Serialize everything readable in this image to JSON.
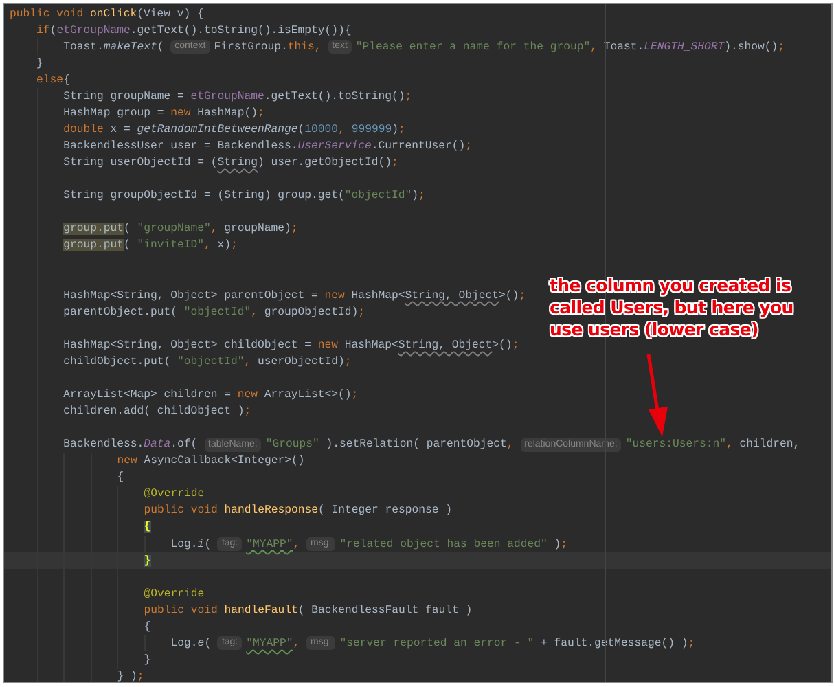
{
  "editor": {
    "lines": [
      {
        "kind": "code",
        "tokens": [
          {
            "kind": "keyword",
            "text": "public void "
          },
          {
            "kind": "method",
            "text": "onClick"
          },
          {
            "kind": "plain",
            "text": "(View v) {"
          }
        ],
        "children": [
          {
            "kind": "code",
            "tokens": [
              {
                "kind": "keyword",
                "text": "if"
              },
              {
                "kind": "plain",
                "text": "("
              },
              {
                "kind": "field",
                "text": "etGroupName"
              },
              {
                "kind": "plain",
                "text": ".getText().toString().isEmpty()){"
              }
            ],
            "children": [
              {
                "kind": "code",
                "tokens": [
                  {
                    "kind": "plain",
                    "text": "Toast."
                  },
                  {
                    "kind": "italic",
                    "text": "makeText"
                  },
                  {
                    "kind": "plain",
                    "text": "( "
                  },
                  {
                    "kind": "hint",
                    "text": "context"
                  },
                  {
                    "kind": "plain",
                    "text": "FirstGroup."
                  },
                  {
                    "kind": "keyword",
                    "text": "this, "
                  },
                  {
                    "kind": "hint",
                    "text": "text"
                  },
                  {
                    "kind": "string",
                    "text": "\"Please enter a name for the group\""
                  },
                  {
                    "kind": "keyword",
                    "text": ", "
                  },
                  {
                    "kind": "plain",
                    "text": "Toast."
                  },
                  {
                    "kind": "static",
                    "text": "LENGTH_SHORT"
                  },
                  {
                    "kind": "plain",
                    "text": ").show()"
                  },
                  {
                    "kind": "keyword",
                    "text": ";"
                  }
                ]
              }
            ]
          },
          {
            "kind": "code",
            "tokens": [
              {
                "kind": "plain",
                "text": "}"
              }
            ]
          },
          {
            "kind": "code",
            "tokens": [
              {
                "kind": "keyword",
                "text": "else"
              },
              {
                "kind": "plain",
                "text": "{"
              }
            ],
            "children": [
              {
                "kind": "code",
                "tokens": [
                  {
                    "kind": "plain",
                    "text": "String groupName = "
                  },
                  {
                    "kind": "field",
                    "text": "etGroupName"
                  },
                  {
                    "kind": "plain",
                    "text": ".getText().toString()"
                  },
                  {
                    "kind": "keyword",
                    "text": ";"
                  }
                ]
              },
              {
                "kind": "code",
                "tokens": [
                  {
                    "kind": "plain",
                    "text": "HashMap group = "
                  },
                  {
                    "kind": "keyword",
                    "text": "new "
                  },
                  {
                    "kind": "plain",
                    "text": "HashMap()"
                  },
                  {
                    "kind": "keyword",
                    "text": ";"
                  }
                ]
              },
              {
                "kind": "code",
                "tokens": [
                  {
                    "kind": "keyword",
                    "text": "double "
                  },
                  {
                    "kind": "plain",
                    "text": "x = "
                  },
                  {
                    "kind": "italic",
                    "text": "getRandomIntBetweenRange"
                  },
                  {
                    "kind": "plain",
                    "text": "("
                  },
                  {
                    "kind": "number",
                    "text": "10000"
                  },
                  {
                    "kind": "keyword",
                    "text": ", "
                  },
                  {
                    "kind": "number",
                    "text": "999999"
                  },
                  {
                    "kind": "plain",
                    "text": ")"
                  },
                  {
                    "kind": "keyword",
                    "text": ";"
                  }
                ]
              },
              {
                "kind": "code",
                "tokens": [
                  {
                    "kind": "plain",
                    "text": "BackendlessUser user = Backendless."
                  },
                  {
                    "kind": "static",
                    "text": "UserService"
                  },
                  {
                    "kind": "plain",
                    "text": ".CurrentUser()"
                  },
                  {
                    "kind": "keyword",
                    "text": ";"
                  }
                ]
              },
              {
                "kind": "code",
                "tokens": [
                  {
                    "kind": "plain",
                    "text": "String userObjectId = ("
                  },
                  {
                    "kind": "plain",
                    "text": "String",
                    "squiggly": true
                  },
                  {
                    "kind": "plain",
                    "text": ") user.getObjectId()"
                  },
                  {
                    "kind": "keyword",
                    "text": ";"
                  }
                ]
              },
              {
                "kind": "blank"
              },
              {
                "kind": "code",
                "tokens": [
                  {
                    "kind": "plain",
                    "text": "String groupObjectId = (String) group.get("
                  },
                  {
                    "kind": "string",
                    "text": "\"objectId\""
                  },
                  {
                    "kind": "plain",
                    "text": ")"
                  },
                  {
                    "kind": "keyword",
                    "text": ";"
                  }
                ]
              },
              {
                "kind": "blank"
              },
              {
                "kind": "code",
                "tokens": [
                  {
                    "kind": "plain",
                    "text": "group.put",
                    "highlighted": true
                  },
                  {
                    "kind": "plain",
                    "text": "( "
                  },
                  {
                    "kind": "string",
                    "text": "\"groupName\""
                  },
                  {
                    "kind": "keyword",
                    "text": ", "
                  },
                  {
                    "kind": "plain",
                    "text": "groupName)"
                  },
                  {
                    "kind": "keyword",
                    "text": ";"
                  }
                ]
              },
              {
                "kind": "code",
                "tokens": [
                  {
                    "kind": "plain",
                    "text": "group.put",
                    "highlighted": true
                  },
                  {
                    "kind": "plain",
                    "text": "( "
                  },
                  {
                    "kind": "string",
                    "text": "\"inviteID\""
                  },
                  {
                    "kind": "keyword",
                    "text": ", "
                  },
                  {
                    "kind": "plain",
                    "text": "x)"
                  },
                  {
                    "kind": "keyword",
                    "text": ";"
                  }
                ]
              },
              {
                "kind": "blank"
              },
              {
                "kind": "blank"
              },
              {
                "kind": "code",
                "tokens": [
                  {
                    "kind": "plain",
                    "text": "HashMap<String, Object> parentObject = "
                  },
                  {
                    "kind": "keyword",
                    "text": "new "
                  },
                  {
                    "kind": "plain",
                    "text": "HashMap<"
                  },
                  {
                    "kind": "plain",
                    "text": "String, Object",
                    "squiggly": true
                  },
                  {
                    "kind": "plain",
                    "text": ">()"
                  },
                  {
                    "kind": "keyword",
                    "text": ";"
                  }
                ]
              },
              {
                "kind": "code",
                "tokens": [
                  {
                    "kind": "plain",
                    "text": "parentObject.put( "
                  },
                  {
                    "kind": "string",
                    "text": "\"objectId\""
                  },
                  {
                    "kind": "keyword",
                    "text": ", "
                  },
                  {
                    "kind": "plain",
                    "text": "groupObjectId)"
                  },
                  {
                    "kind": "keyword",
                    "text": ";"
                  }
                ]
              },
              {
                "kind": "blank"
              },
              {
                "kind": "code",
                "tokens": [
                  {
                    "kind": "plain",
                    "text": "HashMap<String, Object> childObject = "
                  },
                  {
                    "kind": "keyword",
                    "text": "new "
                  },
                  {
                    "kind": "plain",
                    "text": "HashMap<"
                  },
                  {
                    "kind": "plain",
                    "text": "String, Object",
                    "squiggly": true
                  },
                  {
                    "kind": "plain",
                    "text": ">()"
                  },
                  {
                    "kind": "keyword",
                    "text": ";"
                  }
                ]
              },
              {
                "kind": "code",
                "tokens": [
                  {
                    "kind": "plain",
                    "text": "childObject.put( "
                  },
                  {
                    "kind": "string",
                    "text": "\"objectId\""
                  },
                  {
                    "kind": "keyword",
                    "text": ", "
                  },
                  {
                    "kind": "plain",
                    "text": "userObjectId)"
                  },
                  {
                    "kind": "keyword",
                    "text": ";"
                  }
                ]
              },
              {
                "kind": "blank"
              },
              {
                "kind": "code",
                "tokens": [
                  {
                    "kind": "plain",
                    "text": "ArrayList<Map> children = "
                  },
                  {
                    "kind": "keyword",
                    "text": "new "
                  },
                  {
                    "kind": "plain",
                    "text": "ArrayList<>()"
                  },
                  {
                    "kind": "keyword",
                    "text": ";"
                  }
                ]
              },
              {
                "kind": "code",
                "tokens": [
                  {
                    "kind": "plain",
                    "text": "children.add( childObject )"
                  },
                  {
                    "kind": "keyword",
                    "text": ";"
                  }
                ]
              },
              {
                "kind": "blank"
              },
              {
                "kind": "code",
                "tokens": [
                  {
                    "kind": "plain",
                    "text": "Backendless."
                  },
                  {
                    "kind": "static",
                    "text": "Data"
                  },
                  {
                    "kind": "plain",
                    "text": ".of( "
                  },
                  {
                    "kind": "hint",
                    "text": "tableName:"
                  },
                  {
                    "kind": "string",
                    "text": "\"Groups\""
                  },
                  {
                    "kind": "plain",
                    "text": " ).setRelation( parentObject"
                  },
                  {
                    "kind": "keyword",
                    "text": ", "
                  },
                  {
                    "kind": "hint",
                    "text": "relationColumnName:"
                  },
                  {
                    "kind": "string",
                    "text": "\"users:Users:n\""
                  },
                  {
                    "kind": "keyword",
                    "text": ", "
                  },
                  {
                    "kind": "plain",
                    "text": "children,"
                  }
                ],
                "children": [
                  {
                    "children": [
                      {
                        "kind": "code",
                        "tokens": [
                          {
                            "kind": "keyword",
                            "text": "new "
                          },
                          {
                            "kind": "plain",
                            "text": "AsyncCallback<Integer>()"
                          }
                        ]
                      },
                      {
                        "kind": "code",
                        "tokens": [
                          {
                            "kind": "plain",
                            "text": "{"
                          }
                        ],
                        "children": [
                          {
                            "kind": "code",
                            "tokens": [
                              {
                                "kind": "annotation",
                                "text": "@Override"
                              }
                            ]
                          },
                          {
                            "kind": "code",
                            "tokens": [
                              {
                                "kind": "keyword",
                                "text": "public void "
                              },
                              {
                                "kind": "method",
                                "text": "handleResponse"
                              },
                              {
                                "kind": "plain",
                                "text": "( Integer response )"
                              }
                            ]
                          },
                          {
                            "kind": "code",
                            "tokens": [
                              {
                                "kind": "plain",
                                "text": "{",
                                "matched": true
                              }
                            ],
                            "children": [
                              {
                                "kind": "code",
                                "tokens": [
                                  {
                                    "kind": "plain",
                                    "text": "Log."
                                  },
                                  {
                                    "kind": "italic",
                                    "text": "i"
                                  },
                                  {
                                    "kind": "plain",
                                    "text": "( "
                                  },
                                  {
                                    "kind": "hint",
                                    "text": "tag:"
                                  },
                                  {
                                    "kind": "string",
                                    "text": "\"MYAPP\"",
                                    "squiggly": true
                                  },
                                  {
                                    "kind": "keyword",
                                    "text": ", "
                                  },
                                  {
                                    "kind": "hint",
                                    "text": "msg:"
                                  },
                                  {
                                    "kind": "string",
                                    "text": "\"related object has been added\""
                                  },
                                  {
                                    "kind": "plain",
                                    "text": " )"
                                  },
                                  {
                                    "kind": "keyword",
                                    "text": ";"
                                  }
                                ]
                              }
                            ]
                          },
                          {
                            "kind": "code",
                            "current": true,
                            "tokens": [
                              {
                                "kind": "plain",
                                "text": "}",
                                "matched": true
                              }
                            ]
                          },
                          {
                            "kind": "blank"
                          },
                          {
                            "kind": "code",
                            "tokens": [
                              {
                                "kind": "annotation",
                                "text": "@Override"
                              }
                            ]
                          },
                          {
                            "kind": "code",
                            "tokens": [
                              {
                                "kind": "keyword",
                                "text": "public void "
                              },
                              {
                                "kind": "method",
                                "text": "handleFault"
                              },
                              {
                                "kind": "plain",
                                "text": "( BackendlessFault fault )"
                              }
                            ]
                          },
                          {
                            "kind": "code",
                            "tokens": [
                              {
                                "kind": "plain",
                                "text": "{"
                              }
                            ],
                            "children": [
                              {
                                "kind": "code",
                                "tokens": [
                                  {
                                    "kind": "plain",
                                    "text": "Log."
                                  },
                                  {
                                    "kind": "italic",
                                    "text": "e"
                                  },
                                  {
                                    "kind": "plain",
                                    "text": "( "
                                  },
                                  {
                                    "kind": "hint",
                                    "text": "tag:"
                                  },
                                  {
                                    "kind": "string",
                                    "text": "\"MYAPP\"",
                                    "squiggly": true
                                  },
                                  {
                                    "kind": "keyword",
                                    "text": ", "
                                  },
                                  {
                                    "kind": "hint",
                                    "text": "msg:"
                                  },
                                  {
                                    "kind": "string",
                                    "text": "\"server reported an error - \""
                                  },
                                  {
                                    "kind": "plain",
                                    "text": " + fault.getMessage() )"
                                  },
                                  {
                                    "kind": "keyword",
                                    "text": ";"
                                  }
                                ]
                              }
                            ]
                          },
                          {
                            "kind": "code",
                            "tokens": [
                              {
                                "kind": "plain",
                                "text": "}"
                              }
                            ]
                          }
                        ]
                      },
                      {
                        "kind": "code",
                        "tokens": [
                          {
                            "kind": "plain",
                            "text": "} )"
                          },
                          {
                            "kind": "keyword",
                            "text": ";"
                          }
                        ]
                      }
                    ]
                  }
                ]
              }
            ]
          }
        ]
      }
    ]
  },
  "callout": {
    "text": "the column you created is called Users, but here you use users (lower case)"
  }
}
